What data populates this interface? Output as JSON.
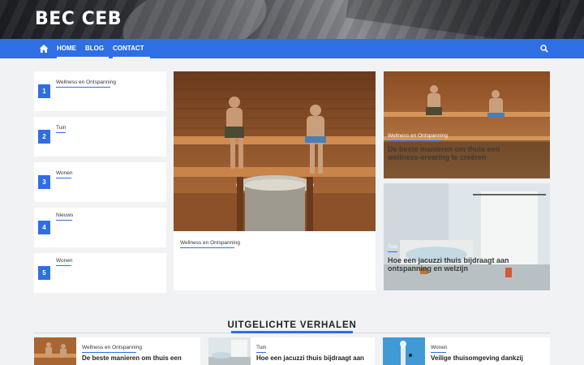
{
  "site": {
    "title": "BEC CEB"
  },
  "nav": {
    "items": [
      {
        "label": "HOME"
      },
      {
        "label": "BLOG"
      },
      {
        "label": "CONTACT"
      }
    ],
    "icons": [
      "home-icon",
      "search-icon"
    ],
    "accent": "#2f6fe4"
  },
  "ranked_list": [
    {
      "number": "1",
      "category": "Wellness en Ontspanning"
    },
    {
      "number": "2",
      "category": "Tuin"
    },
    {
      "number": "3",
      "category": "Wonen"
    },
    {
      "number": "4",
      "category": "Nieuws"
    },
    {
      "number": "5",
      "category": "Wonen"
    }
  ],
  "main_post": {
    "category": "Wellness en Ontspanning"
  },
  "side_posts": [
    {
      "category": "Wellness en Ontspanning",
      "title": "De beste manieren om thuis een wellness-ervaring te creëren"
    },
    {
      "category": "Tuin",
      "title": "Hoe een jacuzzi thuis bijdraagt aan ontspanning en welzijn"
    }
  ],
  "featured": {
    "heading": "UITGELICHTE VERHALEN",
    "items": [
      {
        "category": "Wellness en Ontspanning",
        "title": "De beste manieren om thuis een"
      },
      {
        "category": "Tuin",
        "title": "Hoe een jacuzzi thuis bijdraagt aan"
      },
      {
        "category": "Wonen",
        "title": "Veilige thuisomgeving dankzij"
      }
    ]
  }
}
